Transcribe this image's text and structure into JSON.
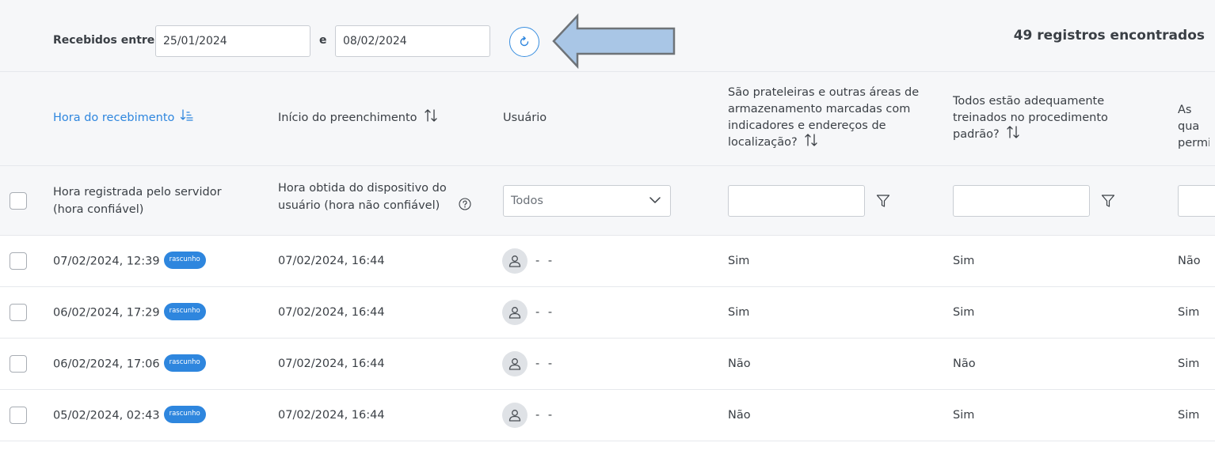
{
  "filter_bar": {
    "range_label": "Recebidos entre",
    "date_from": "25/01/2024",
    "joiner": "e",
    "date_to": "08/02/2024",
    "records_found": "49 registros encontrados"
  },
  "columns": [
    {
      "label": "Hora do recebimento",
      "sorted": true
    },
    {
      "label": "Início do preenchimento"
    },
    {
      "label": "Usuário"
    },
    {
      "label": "São prateleiras e outras áreas de armazenamento marcadas com indicadores e endereços de localização?"
    },
    {
      "label": "Todos estão adequamente treinados no procedimento padrão?"
    },
    {
      "label": "As qua permit"
    }
  ],
  "column_descriptions": {
    "received": "Hora registrada pelo servidor (hora confiável)",
    "started": "Hora obtida do dispositivo do usuário (hora não confiável)"
  },
  "user_filter": {
    "selected": "Todos"
  },
  "rows": [
    {
      "received": "07/02/2024, 12:39",
      "badge": "rascunho",
      "started": "07/02/2024, 16:44",
      "user": "- -",
      "q1": "Sim",
      "q2": "Sim",
      "q3": "Não"
    },
    {
      "received": "06/02/2024, 17:29",
      "badge": "rascunho",
      "started": "07/02/2024, 16:44",
      "user": "- -",
      "q1": "Sim",
      "q2": "Sim",
      "q3": "Sim"
    },
    {
      "received": "06/02/2024, 17:06",
      "badge": "rascunho",
      "started": "07/02/2024, 16:44",
      "user": "- -",
      "q1": "Não",
      "q2": "Não",
      "q3": "Sim"
    },
    {
      "received": "05/02/2024, 02:43",
      "badge": "rascunho",
      "started": "07/02/2024, 16:44",
      "user": "- -",
      "q1": "Não",
      "q2": "Sim",
      "q3": "Sim"
    }
  ],
  "colors": {
    "accent": "#2e86de",
    "annotation_arrow": "#a9c6e6"
  },
  "icons": {
    "refresh": "refresh-icon",
    "sort_active": "sort-ascending-icon",
    "sort": "sort-icon",
    "help": "help-circle-icon",
    "chevron": "chevron-down-icon",
    "filter": "funnel-icon",
    "avatar": "user-icon"
  }
}
